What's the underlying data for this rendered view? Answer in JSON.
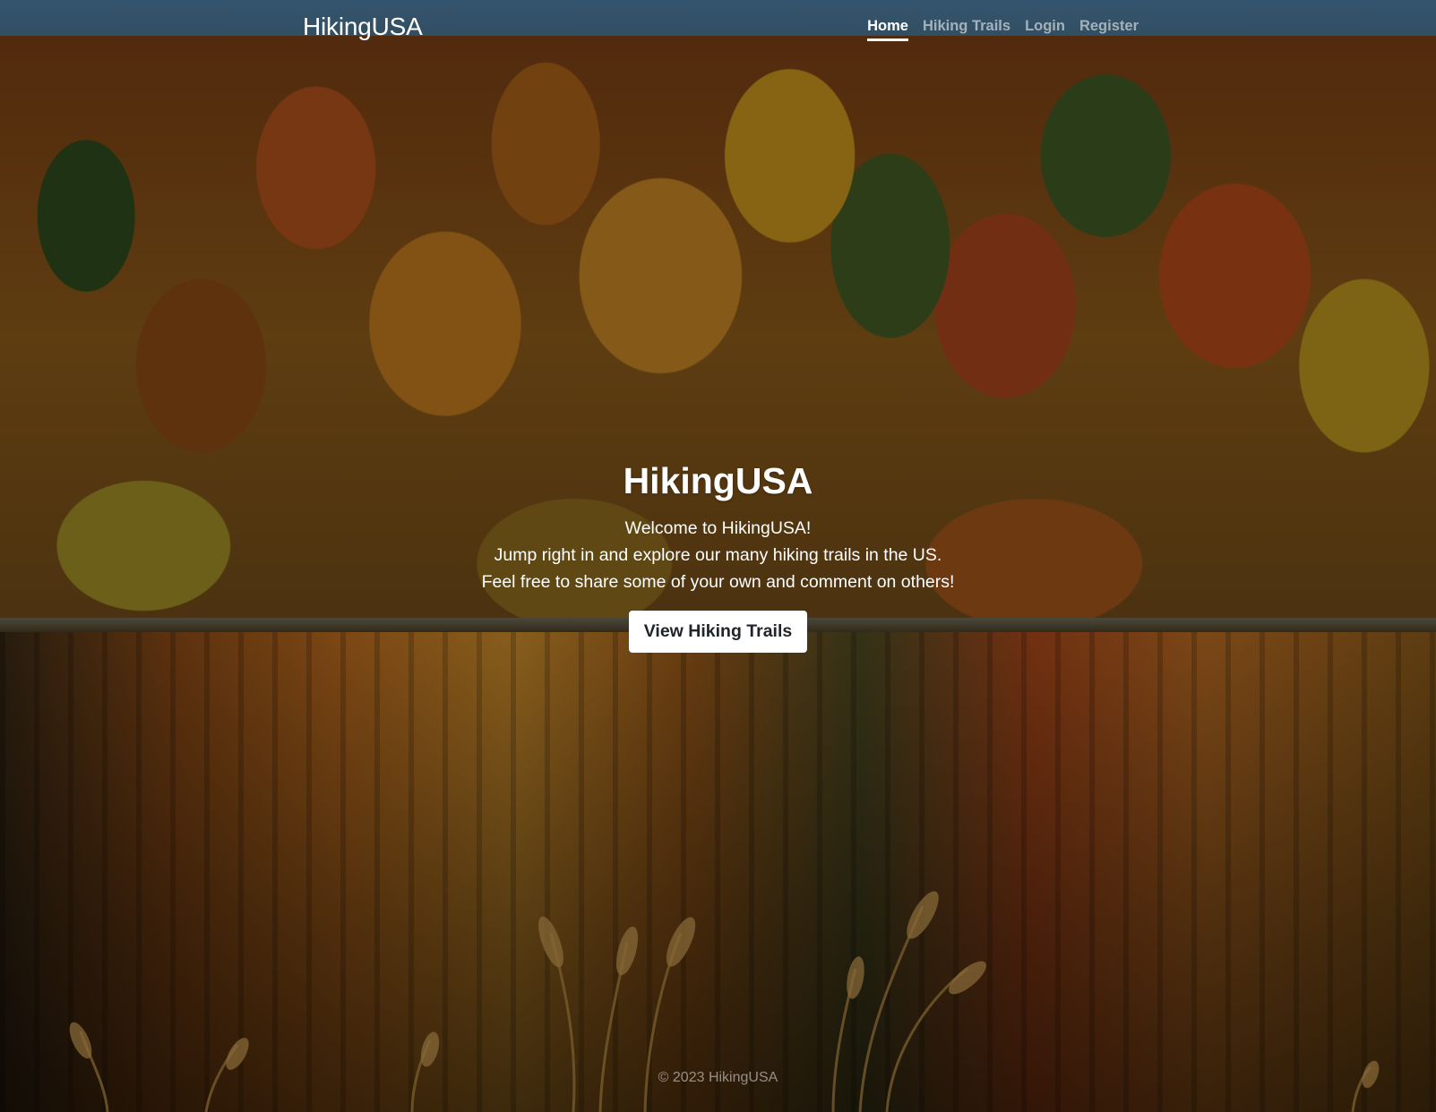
{
  "navbar": {
    "brand": "HikingUSA",
    "links": [
      {
        "label": "Home",
        "active": true
      },
      {
        "label": "Hiking Trails",
        "active": false
      },
      {
        "label": "Login",
        "active": false
      },
      {
        "label": "Register",
        "active": false
      }
    ]
  },
  "hero": {
    "title": "HikingUSA",
    "lines": [
      "Welcome to HikingUSA!",
      "Jump right in and explore our many hiking trails in the US.",
      "Feel free to share some of your own and comment on others!"
    ],
    "cta_label": "View Hiking Trails"
  },
  "footer": {
    "text": "© 2023 HikingUSA"
  },
  "colors": {
    "active_link": "#ffffff",
    "inactive_link": "rgba(255,255,255,0.55)",
    "button_bg": "#ffffff",
    "button_text": "#212529"
  },
  "background": {
    "image_subject": "autumn-forest-lake"
  }
}
